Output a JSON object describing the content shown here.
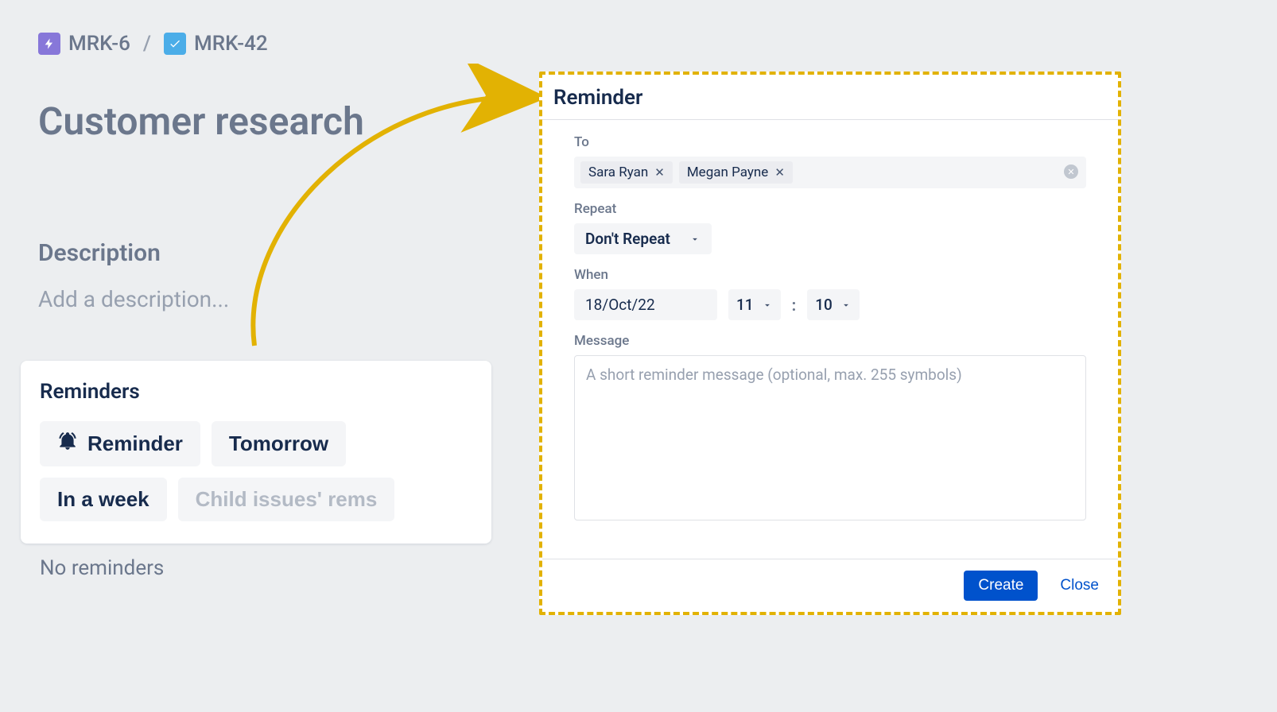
{
  "breadcrumb": {
    "items": [
      {
        "key": "MRK-6",
        "iconType": "epic"
      },
      {
        "key": "MRK-42",
        "iconType": "task"
      }
    ],
    "separator": "/"
  },
  "issue": {
    "title": "Customer research",
    "descriptionHeading": "Description",
    "descriptionPlaceholder": "Add a description..."
  },
  "remindersPanel": {
    "title": "Reminders",
    "buttons": {
      "reminder": "Reminder",
      "tomorrow": "Tomorrow",
      "inAWeek": "In a week",
      "childIssues": "Child issues' rems"
    },
    "noReminders": "No reminders"
  },
  "dialog": {
    "title": "Reminder",
    "labels": {
      "to": "To",
      "repeat": "Repeat",
      "when": "When",
      "message": "Message"
    },
    "to": {
      "chips": [
        "Sara Ryan",
        "Megan Payne"
      ]
    },
    "repeat": {
      "selected": "Don't Repeat"
    },
    "when": {
      "date": "18/Oct/22",
      "hour": "11",
      "minute": "10",
      "separator": ":"
    },
    "message": {
      "placeholder": "A short reminder message (optional, max. 255 symbols)"
    },
    "actions": {
      "create": "Create",
      "close": "Close"
    }
  },
  "colors": {
    "accentYellow": "#e2b203",
    "primary": "#0052cc"
  }
}
